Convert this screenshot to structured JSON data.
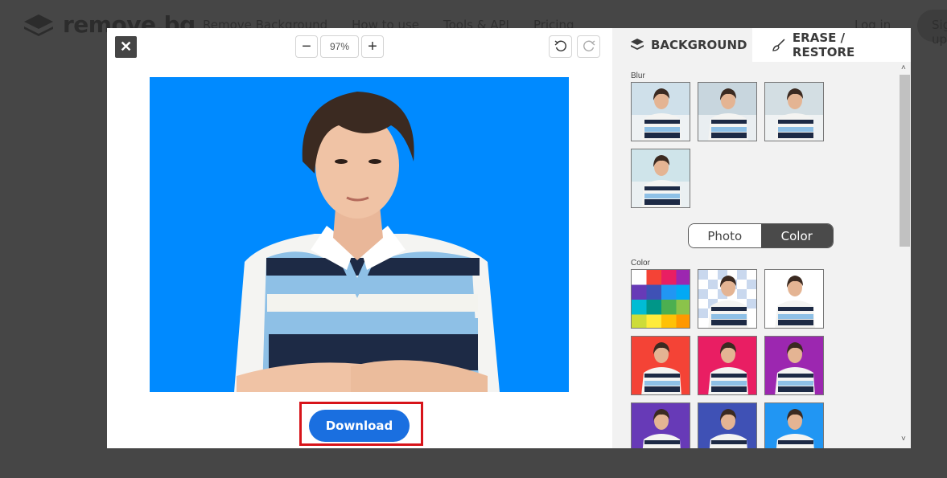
{
  "site": {
    "logo_text": "remove.bg",
    "nav": [
      "Remove Background",
      "How to use",
      "Tools & API",
      "Pricing"
    ],
    "login": "Log in",
    "signup": "Sign up"
  },
  "editor": {
    "zoom_value": "97%",
    "zoom_out_label": "−",
    "zoom_in_label": "+",
    "background_color": "#008aff",
    "download_label": "Download"
  },
  "panel": {
    "tabs": [
      {
        "label": "BACKGROUND",
        "icon": "layers-icon"
      },
      {
        "label": "ERASE / RESTORE",
        "icon": "brush-icon"
      }
    ],
    "blur_label": "Blur",
    "toggle": {
      "photo": "Photo",
      "color": "Color",
      "selected": "Color"
    },
    "color_label": "Color",
    "color_swatches": [
      "transparent",
      "#ffffff",
      "#f44336",
      "#e91e63",
      "#9c27b0",
      "#673ab7",
      "#3f51b5",
      "#2196f3"
    ]
  }
}
